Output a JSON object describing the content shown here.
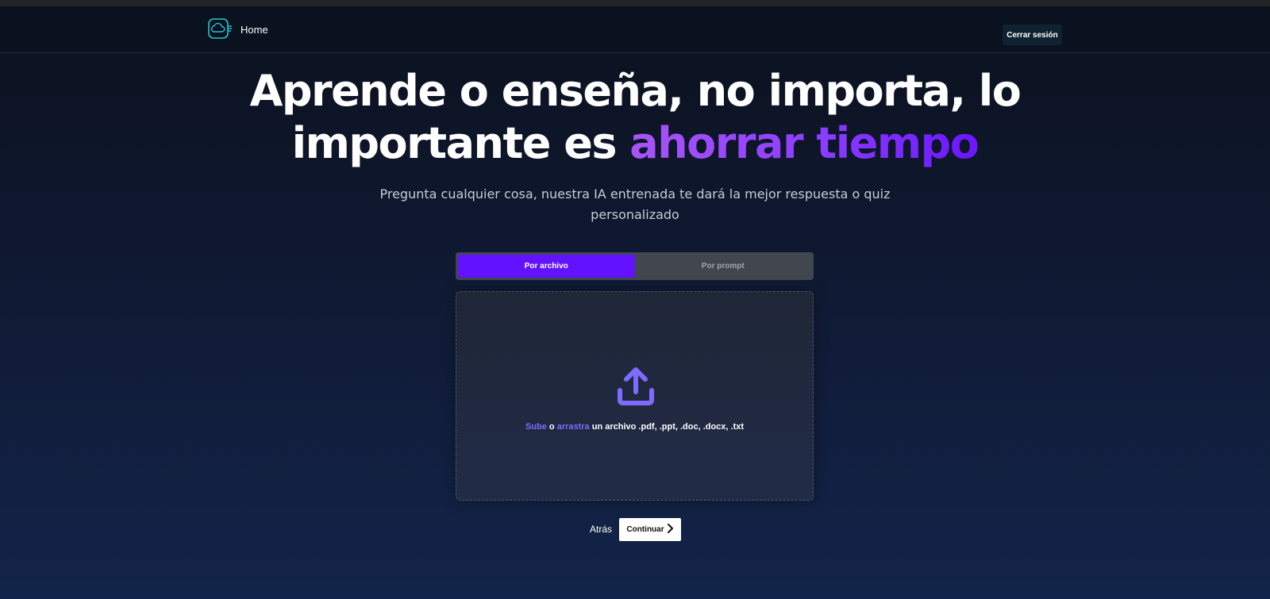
{
  "navbar": {
    "logo_icon": "cloud-book-icon",
    "home_label": "Home",
    "logout_label": "Cerrar sesión"
  },
  "hero": {
    "title_part1": "Aprende o enseña, no importa, lo importante es ",
    "title_accent": "ahorrar tiempo",
    "subtitle": "Pregunta cualquier cosa, nuestra IA entrenada te dará la mejor respuesta o quiz personalizado"
  },
  "tabs": [
    {
      "label": "Por archivo",
      "active": true
    },
    {
      "label": "Por prompt",
      "active": false
    }
  ],
  "dropzone": {
    "icon": "upload-icon",
    "upload_link": "Sube",
    "connector": " o ",
    "drag_link": "arrastra",
    "formats_text": " un archivo .pdf, .ppt, .doc, .docx, .txt"
  },
  "actions": {
    "back_label": "Atrás",
    "continue_label": "Continuar",
    "continue_icon": "chevron-right-icon"
  },
  "colors": {
    "accent": "#6212ff",
    "link": "#7f6bff",
    "logo": "#1fc7d4"
  }
}
